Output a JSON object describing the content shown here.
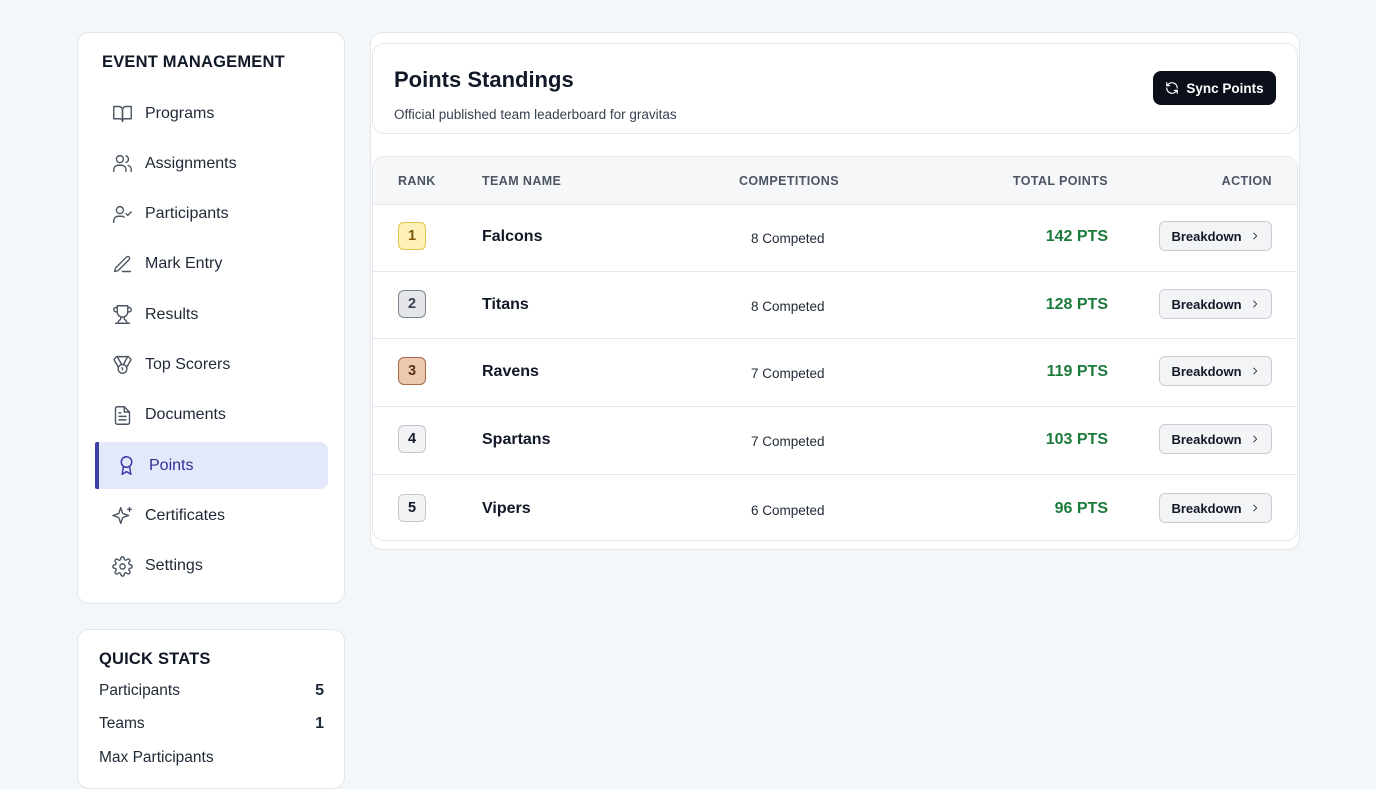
{
  "sidebar": {
    "title": "EVENT MANAGEMENT",
    "items": [
      {
        "label": "Programs",
        "icon": "book-open-icon"
      },
      {
        "label": "Assignments",
        "icon": "users-icon"
      },
      {
        "label": "Participants",
        "icon": "user-check-icon"
      },
      {
        "label": "Mark Entry",
        "icon": "pencil-icon"
      },
      {
        "label": "Results",
        "icon": "trophy-icon"
      },
      {
        "label": "Top Scorers",
        "icon": "medal-icon"
      },
      {
        "label": "Documents",
        "icon": "file-text-icon"
      },
      {
        "label": "Points",
        "icon": "award-icon",
        "active": true
      },
      {
        "label": "Certificates",
        "icon": "sparkles-icon"
      },
      {
        "label": "Settings",
        "icon": "gear-icon"
      }
    ]
  },
  "quick_stats": {
    "title": "QUICK STATS",
    "rows": [
      {
        "label": "Participants",
        "value": "5"
      },
      {
        "label": "Teams",
        "value": "1"
      },
      {
        "label": "Max Participants",
        "value": ""
      }
    ]
  },
  "header": {
    "title": "Points Standings",
    "subtitle": "Official published team leaderboard for gravitas",
    "sync_label": "Sync Points"
  },
  "table": {
    "columns": {
      "rank": "RANK",
      "team": "TEAM NAME",
      "competitions": "COMPETITIONS",
      "points": "TOTAL POINTS",
      "action": "ACTION"
    },
    "rows": [
      {
        "rank": "1",
        "team": "Falcons",
        "competed": "8 Competed",
        "points": "142 PTS",
        "action": "Breakdown"
      },
      {
        "rank": "2",
        "team": "Titans",
        "competed": "8 Competed",
        "points": "128 PTS",
        "action": "Breakdown"
      },
      {
        "rank": "3",
        "team": "Ravens",
        "competed": "7 Competed",
        "points": "119 PTS",
        "action": "Breakdown"
      },
      {
        "rank": "4",
        "team": "Spartans",
        "competed": "7 Competed",
        "points": "103 PTS",
        "action": "Breakdown"
      },
      {
        "rank": "5",
        "team": "Vipers",
        "competed": "6 Competed",
        "points": "96 PTS",
        "action": "Breakdown"
      }
    ]
  },
  "colors": {
    "accent": "#3d3fa8",
    "active_bg": "#e4e8fb",
    "points_green": "#1c7a3b",
    "gold_bg": "#fdf0b8",
    "gold_border": "#e5c248",
    "silver_bg": "#e4e6e9",
    "silver_border": "#7d8590",
    "bronze_bg": "#ecc9b1",
    "bronze_border": "#a86a43",
    "default_rank_bg": "#f1f3f5",
    "default_rank_border": "#c3c7cd"
  }
}
